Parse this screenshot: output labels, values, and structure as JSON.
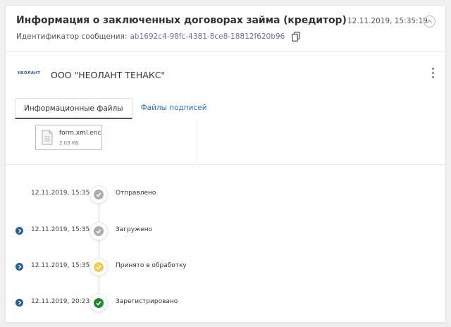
{
  "header": {
    "title": "Информация о заключенных договорах займа (кредитор)",
    "message_id_label": "Идентификатор сообщения:",
    "message_id_value": "ab1692c4-98fc-4381-8ce8-18812f620b96",
    "timestamp": "12.11.2019, 15:35:19"
  },
  "org": {
    "logo_text": "НЕОЛАНТ",
    "name": "ООО \"НЕОЛАНТ ТЕНАКС\""
  },
  "tabs": [
    {
      "label": "Информационные файлы",
      "active": true
    },
    {
      "label": "Файлы подписей",
      "active": false
    }
  ],
  "files": [
    {
      "name": "form.xml.enc",
      "size": "2.03 КБ"
    }
  ],
  "timeline": [
    {
      "time": "12.11.2019, 15:35",
      "label": "Отправлено",
      "status": "gray",
      "expandable": false
    },
    {
      "time": "12.11.2019, 15:35",
      "label": "Загружено",
      "status": "gray",
      "expandable": true
    },
    {
      "time": "12.11.2019, 15:35",
      "label": "Принято в обработку",
      "status": "yellow",
      "expandable": true
    },
    {
      "time": "12.11.2019, 20:23",
      "label": "Зарегистрировано",
      "status": "green",
      "expandable": true
    }
  ],
  "colors": {
    "link": "#7b67b3",
    "tab_link": "#2f6fae",
    "status_gray": "#a9acb0",
    "status_yellow": "#f0cf4a",
    "status_green": "#1e8a2e",
    "expand_blue": "#1f5f97"
  },
  "icons": {
    "copy": "copy-icon",
    "collapse": "chevron-up-icon",
    "menu": "kebab-menu-icon",
    "file": "document-icon",
    "expand": "chevron-right-icon",
    "check": "check-icon"
  }
}
